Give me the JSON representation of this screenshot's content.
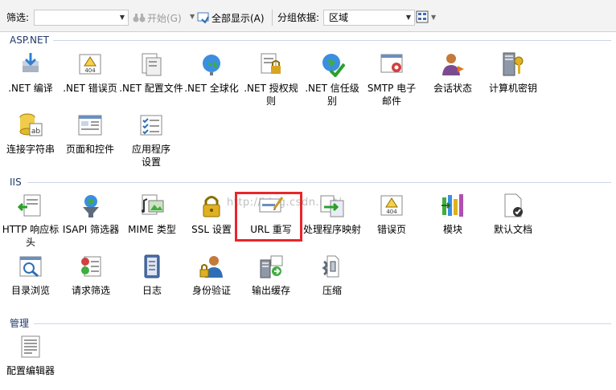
{
  "toolbar": {
    "filter_label": "筛选:",
    "filter_value": "",
    "start_label": "开始(G)",
    "show_all_label": "全部显示(A)",
    "group_by_label": "分组依据:",
    "group_by_value": "区域"
  },
  "watermark": "http://blog.csdn.net/",
  "sections": [
    {
      "title": "ASP.NET",
      "items": [
        {
          "label": ".NET 编译",
          "icon": "dotnet-compile-icon"
        },
        {
          "label": ".NET 错误页",
          "icon": "dotnet-error-page-icon"
        },
        {
          "label": ".NET 配置文件",
          "icon": "dotnet-profile-icon"
        },
        {
          "label": ".NET 全球化",
          "icon": "dotnet-globalization-icon"
        },
        {
          "label": ".NET 授权规则",
          "icon": "dotnet-authorization-icon"
        },
        {
          "label": ".NET 信任级别",
          "icon": "dotnet-trust-level-icon"
        },
        {
          "label": "SMTP 电子邮件",
          "icon": "smtp-email-icon"
        },
        {
          "label": "会话状态",
          "icon": "session-state-icon"
        },
        {
          "label": "计算机密钥",
          "icon": "machine-key-icon"
        },
        {
          "label": "连接字符串",
          "icon": "connection-string-icon"
        },
        {
          "label": "页面和控件",
          "icon": "pages-controls-icon"
        },
        {
          "label": "应用程序设置",
          "icon": "app-settings-icon"
        }
      ]
    },
    {
      "title": "IIS",
      "items": [
        {
          "label": "HTTP 响应标头",
          "icon": "http-response-headers-icon"
        },
        {
          "label": "ISAPI 筛选器",
          "icon": "isapi-filters-icon"
        },
        {
          "label": "MIME 类型",
          "icon": "mime-types-icon"
        },
        {
          "label": "SSL 设置",
          "icon": "ssl-settings-icon"
        },
        {
          "label": "URL 重写",
          "icon": "url-rewrite-icon"
        },
        {
          "label": "处理程序映射",
          "icon": "handler-mappings-icon"
        },
        {
          "label": "错误页",
          "icon": "error-pages-icon"
        },
        {
          "label": "模块",
          "icon": "modules-icon"
        },
        {
          "label": "默认文档",
          "icon": "default-document-icon"
        },
        {
          "label": "目录浏览",
          "icon": "directory-browsing-icon"
        },
        {
          "label": "请求筛选",
          "icon": "request-filtering-icon"
        },
        {
          "label": "日志",
          "icon": "logging-icon"
        },
        {
          "label": "身份验证",
          "icon": "authentication-icon"
        },
        {
          "label": "输出缓存",
          "icon": "output-caching-icon"
        },
        {
          "label": "压缩",
          "icon": "compression-icon"
        }
      ]
    },
    {
      "title": "管理",
      "items": [
        {
          "label": "配置编辑器",
          "icon": "configuration-editor-icon"
        }
      ]
    }
  ]
}
